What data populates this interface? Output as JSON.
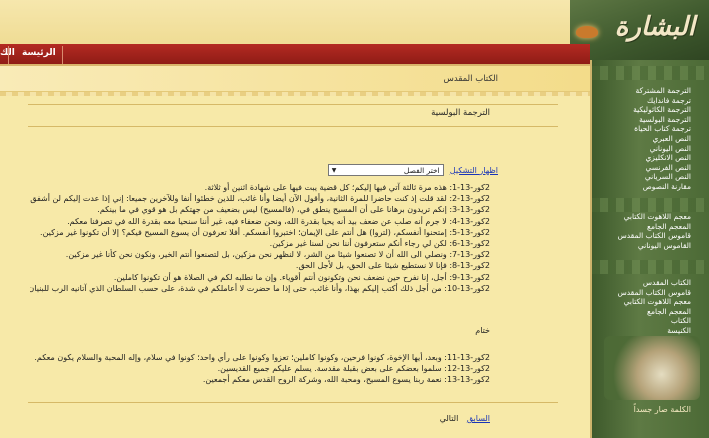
{
  "header": {
    "logo_text": "البشارة"
  },
  "nav": {
    "home": "الرئيسة",
    "home_short": "الك"
  },
  "breadcrumb": "الكتاب المقدس",
  "page_title": "الترجمة البولسية",
  "controls": {
    "show_shapes": "اظهار التشكيل",
    "chapter_select": "اختر الفصل"
  },
  "sidebar": {
    "menu1": [
      "الترجمة المشتركة",
      "ترجمة فاندايك",
      "الترجمة الكاثوليكية",
      "الترجمة البولسية",
      "ترجمة كتاب الحياة",
      "النص العبري",
      "النص اليوناني",
      "النص الانكليزي",
      "النص الفرنسي",
      "النص السرياني",
      "مقارنة النصوص"
    ],
    "menu2": [
      "معجم اللاهوت الكتابي",
      "المعجم الجامع",
      "قاموس الكتاب المقدس",
      "القاموس اليوناني"
    ],
    "menu3": [
      "الكتاب المقدس",
      "قاموس الكتاب المقدس",
      "معجم اللاهوت الكتابي",
      "المعجم الجامع",
      "الكتاب",
      "الكنيسة"
    ],
    "caption": "الكلمة صار جسداً",
    "caption2": "الكلمة صار جسداً"
  },
  "verses": [
    "2كور-13-1: هذه مرة ثالثة آتي فيها إليكم؛ كل قضية يبت فيها على شهادة اثنين أو ثلاثة.",
    "2كور-13-2: لقد قلت إذ كنت حاضرا للمرة الثانية، وأقول الآن أيضا وأنا غائب، للذين خطئوا أنفا وللآخرين جميعا: إني إذا عدت إليكم لن أشفق البتة،",
    "2كور-13-3: إنكم تريدون برهانا على أن المسيح ينطق في، (فالمسيح) ليس بضعيف من جهتكم بل هو قوي في ما بينكم.",
    "2كور-13-4: لا جرم أنه صلب عن ضعف بيد أنه يحيا بقدرة الله، ونحن ضعفاء فيه، غير أننا سنحيا معه بقدرة الله في تصرفنا معكم.",
    "2كور-13-5: إمتحنوا أنفسكم، (لتروا) هل أنتم على الإيمان؛ اختبروا أنفسكم. أفلا تعرفون أن يسوع المسيح فيكم؟ إلا أن تكونوا غير مزكين.",
    "2كور-13-6: لكن لي رجاء أنكم ستعرفون أننا نحن لسنا غير مزكين.",
    "2كور-13-7: ونصلي الى الله أن لا تصنعوا شيئا من الشر، لا لنظهر نحن مزكين، بل لتصنعوا أنتم الخير، ونكون نحن كأنا غير مزكين.",
    "2كور-13-8: فإنا لا نستطيع شيئا على الحق، بل لأجل الحق.",
    "2كور-13-9: أجل، إنا نفرح حين نضعف نحن وتكونون أنتم أقوياء. وإن ما نطلبه لكم في الصلاة هو أن تكونوا كاملين.",
    "2كور-13-10: من أجل ذلك أكتب إليكم بهذا، وأنا غائب، حتى إذا ما حضرت لا أعاملكم في شدة، على حسب السلطان الذي آتانيه الرب للبنيان لا للهدم."
  ],
  "closing_heading": "ختام",
  "closing_verses": [
    "2كور-13-11: وبعد، أيها الإخوة، كونوا فرحين، وكونوا كاملين؛ تعزوا وكونوا على رأي واحد؛ كونوا في سلام، وإله المحبة والسلام يكون معكم.",
    "2كور-13-12: سلموا بعضكم على بعض بقبلة مقدسة. يسلم عليكم جميع القديسين.",
    "2كور-13-13: نعمة ربنا يسوع المسيح، ومحبة الله، وشركة الروح القدس معكم أجمعين."
  ],
  "footer": {
    "prev_link": "السابق",
    "next_label": "التالي"
  }
}
